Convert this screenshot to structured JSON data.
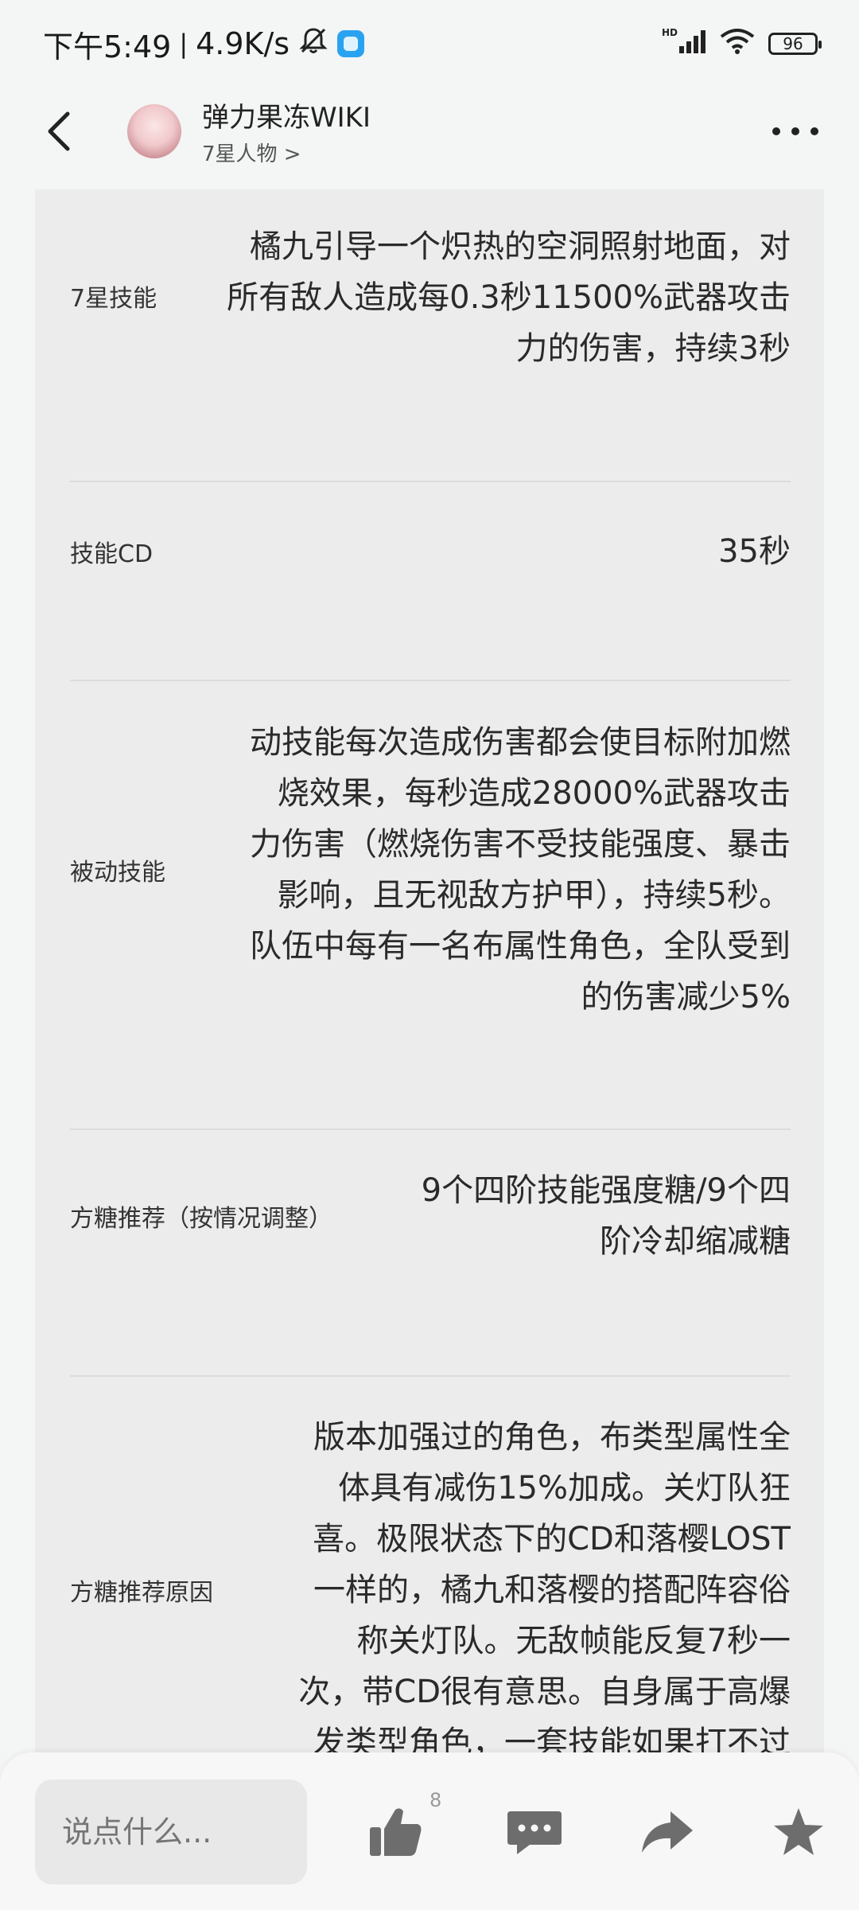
{
  "status_bar": {
    "time": "下午5:49",
    "speed": "4.9K/s",
    "network": "HD",
    "battery": "96"
  },
  "header": {
    "title": "弹力果冻WIKI",
    "subtitle": "7星人物 >"
  },
  "rows": [
    {
      "label": "7星技能",
      "value_lines": [
        "橘九引导一个炽热的空洞照射地面，对",
        "所有敌人造成每0.3秒11500%武器攻击",
        "力的伤害，持续3秒"
      ]
    },
    {
      "label": "技能CD",
      "value_lines": [
        "35秒"
      ]
    },
    {
      "label": "被动技能",
      "value_lines": [
        "动技能每次造成伤害都会使目标附加燃",
        "烧效果，每秒造成28000%武器攻击",
        "力伤害（燃烧伤害不受技能强度、暴击",
        "影响，且无视敌方护甲），持续5秒。",
        "队伍中每有一名布属性角色，全队受到",
        "的伤害减少5%"
      ]
    },
    {
      "label": "方糖推荐（按情况调整）",
      "value_lines": [
        "9个四阶技能强度糖/9个四",
        "阶冷却缩减糖"
      ]
    },
    {
      "label": "方糖推荐原因",
      "value_lines": [
        "版本加强过的角色，布类型属性全",
        "体具有减伤15%加成。关灯队狂",
        "喜。极限状态下的CD和落樱LOST",
        "一样的，橘九和落樱的搭配阵容俗",
        "称关灯队。无敌帧能反复7秒一",
        "次，带CD很有意思。自身属于高爆",
        "发类型角色，一套技能如果打不过"
      ]
    }
  ],
  "bottom_bar": {
    "comment_placeholder": "说点什么...",
    "like_count": "8"
  },
  "icons": {
    "back": "back-arrow-icon",
    "more": "more-dots-icon",
    "like": "thumbs-up-icon",
    "comment": "comment-icon",
    "share": "share-icon",
    "favorite": "star-icon"
  },
  "colors": {
    "content_bg": "#ececec",
    "page_bg": "#f4f5f5",
    "icon_gray": "#6d6d6d"
  }
}
